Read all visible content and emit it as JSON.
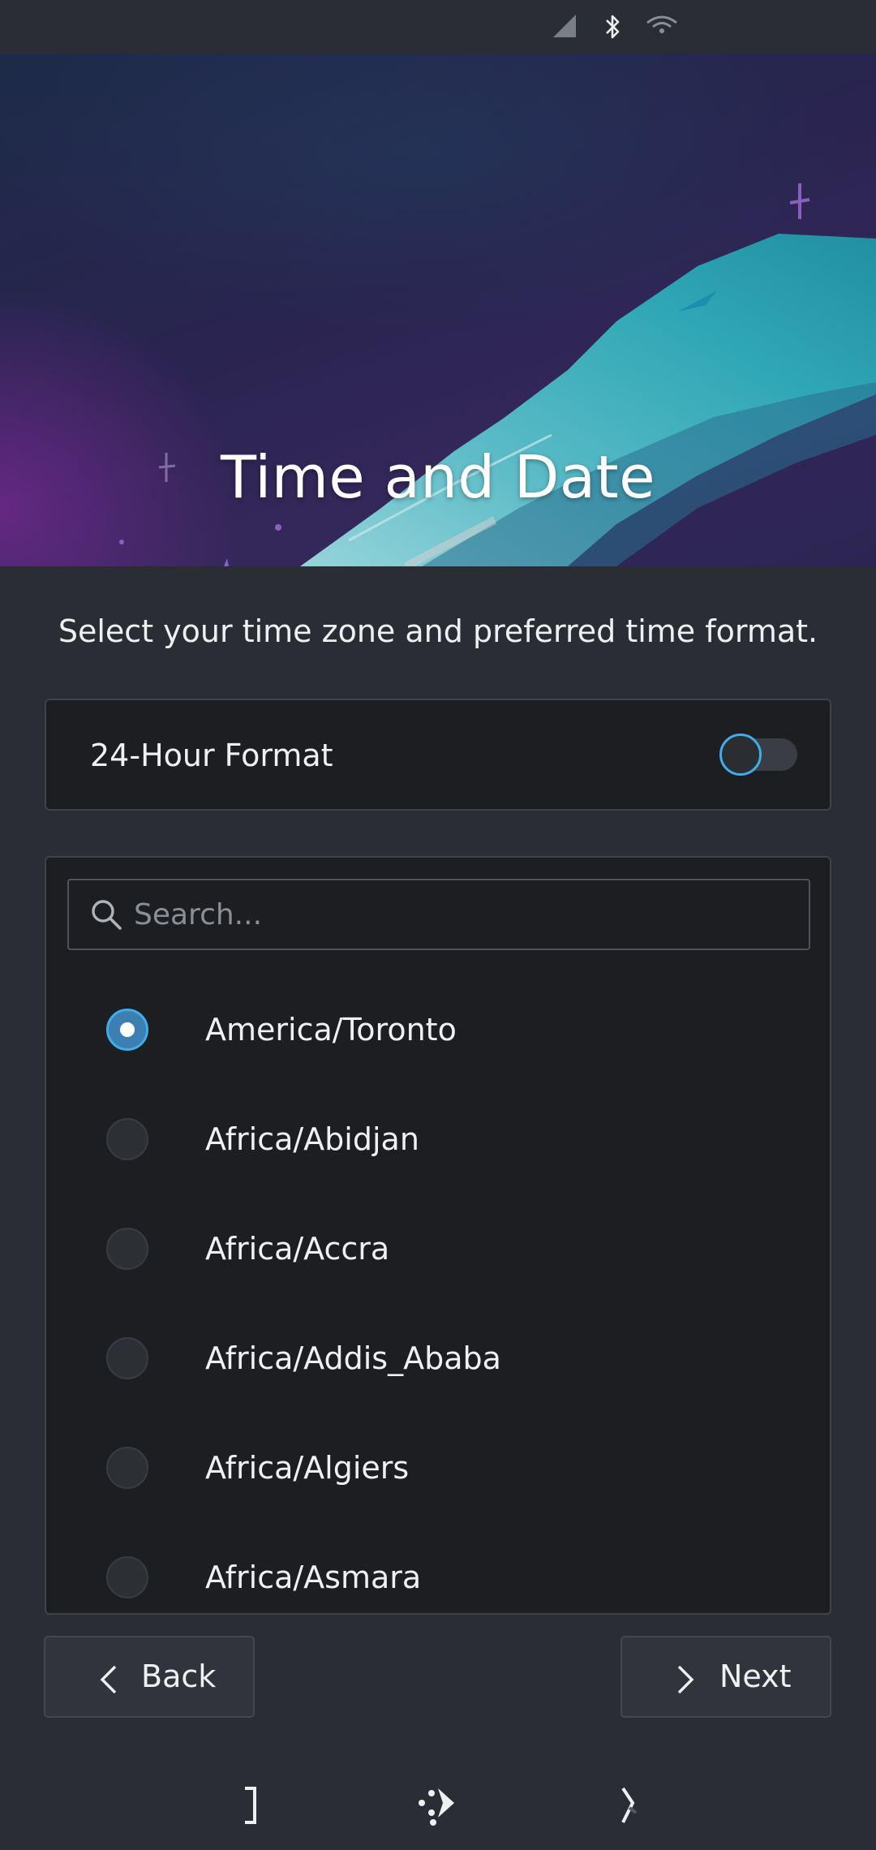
{
  "status_bar": {
    "icons": [
      "signal-icon",
      "bluetooth-icon",
      "wifi-icon"
    ]
  },
  "header": {
    "title": "Time and Date"
  },
  "subtitle": "Select your time zone and preferred time format.",
  "time_format": {
    "label": "24-Hour Format",
    "enabled": false
  },
  "search": {
    "placeholder": "Search..."
  },
  "timezones": [
    {
      "label": "America/Toronto",
      "selected": true
    },
    {
      "label": "Africa/Abidjan",
      "selected": false
    },
    {
      "label": "Africa/Accra",
      "selected": false
    },
    {
      "label": "Africa/Addis_Ababa",
      "selected": false
    },
    {
      "label": "Africa/Algiers",
      "selected": false
    },
    {
      "label": "Africa/Asmara",
      "selected": false
    }
  ],
  "buttons": {
    "back_label": "Back",
    "next_label": "Next"
  },
  "colors": {
    "accent": "#3daee9",
    "background": "#2a2d33",
    "card": "#1c1e22"
  }
}
